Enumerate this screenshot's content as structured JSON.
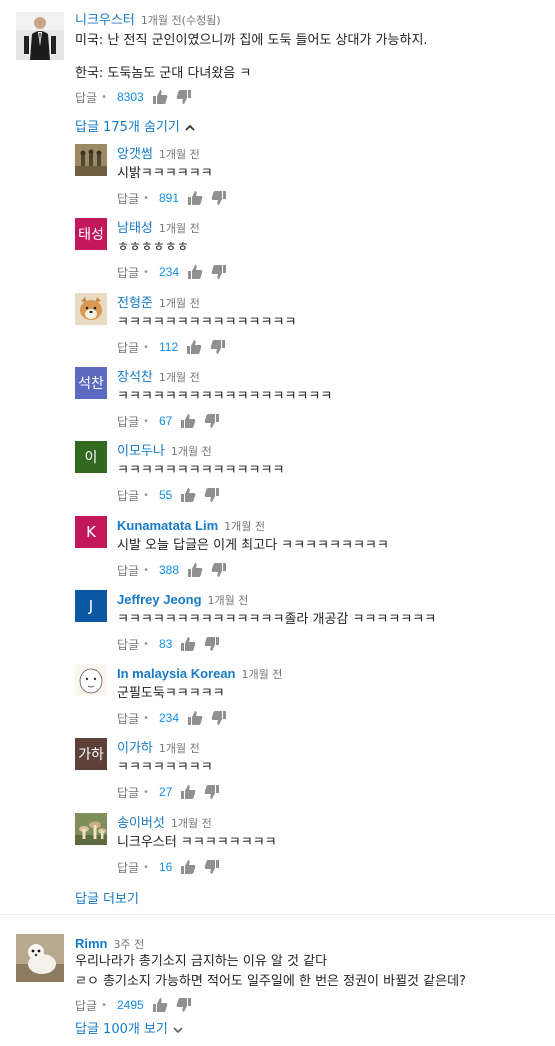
{
  "top_comment": {
    "author": "니크우스터",
    "time": "1개월 전(수정됨)",
    "text_line1": "미국: 난 전직 군인이였으니까 집에 도둑 들어도 상대가 가능하지.",
    "text_line2": "한국: 도둑놈도 군대 다녀왔음 ㅋ",
    "reply_label": "답글",
    "likes": "8303",
    "hide_replies_label": "답글 175개 숨기기"
  },
  "replies": [
    {
      "author": "앙갯썸",
      "time": "1개월 전",
      "text": "시밝ㅋㅋㅋㅋㅋㅋ",
      "reply_label": "답글",
      "likes": "891",
      "avatar_type": "photo",
      "avatar_color": "#7a6a4e"
    },
    {
      "author": "남태성",
      "time": "1개월 전",
      "text": "ㅎㅎㅎㅎㅎㅎ",
      "reply_label": "답글",
      "likes": "234",
      "avatar_type": "letter",
      "avatar_text": "태성",
      "avatar_color": "#c2185b"
    },
    {
      "author": "전형준",
      "time": "1개월 전",
      "text": "ㅋㅋㅋㅋㅋㅋㅋㅋㅋㅋㅋㅋㅋㅋㅋ",
      "reply_label": "답글",
      "likes": "112",
      "avatar_type": "photo",
      "avatar_color": "#c9a46a"
    },
    {
      "author": "장석찬",
      "time": "1개월 전",
      "text": "ㅋㅋㅋㅋㅋㅋㅋㅋㅋㅋㅋㅋㅋㅋㅋㅋㅋㅋ",
      "reply_label": "답글",
      "likes": "67",
      "avatar_type": "letter",
      "avatar_text": "석찬",
      "avatar_color": "#5c6bc0"
    },
    {
      "author": "이모두나",
      "time": "1개월 전",
      "text": "ㅋㅋㅋㅋㅋㅋㅋㅋㅋㅋㅋㅋㅋㅋ",
      "reply_label": "답글",
      "likes": "55",
      "avatar_type": "letter",
      "avatar_text": "이",
      "avatar_color": "#33691e"
    },
    {
      "author": "Kunamatata Lim",
      "time": "1개월 전",
      "text": "시발 오늘 답글은 이게 최고다 ㅋㅋㅋㅋㅋㅋㅋㅋㅋ",
      "reply_label": "답글",
      "likes": "388",
      "avatar_type": "letter",
      "avatar_text": "K",
      "avatar_color": "#c2185b"
    },
    {
      "author": "Jeffrey Jeong",
      "time": "1개월 전",
      "text": "ㅋㅋㅋㅋㅋㅋㅋㅋㅋㅋㅋㅋㅋㅋ졸라 개공감 ㅋㅋㅋㅋㅋㅋㅋ",
      "reply_label": "답글",
      "likes": "83",
      "avatar_type": "letter",
      "avatar_text": "J",
      "avatar_color": "#0b57a4"
    },
    {
      "author": "In malaysia Korean",
      "time": "1개월 전",
      "text": "군필도둑ㅋㅋㅋㅋㅋ",
      "reply_label": "답글",
      "likes": "234",
      "avatar_type": "photo",
      "avatar_color": "#f1e6d4"
    },
    {
      "author": "이가하",
      "time": "1개월 전",
      "text": "ㅋㅋㅋㅋㅋㅋㅋㅋ",
      "reply_label": "답글",
      "likes": "27",
      "avatar_type": "letter",
      "avatar_text": "가하",
      "avatar_color": "#5d4037"
    },
    {
      "author": "송이버섯",
      "time": "1개월 전",
      "text": "니크우스터 ㅋㅋㅋㅋㅋㅋㅋㅋ",
      "reply_label": "답글",
      "likes": "16",
      "avatar_type": "photo",
      "avatar_color": "#9aa37a"
    }
  ],
  "more_replies_label": "답글 더보기",
  "second_comment": {
    "author": "Rimn",
    "time": "3주 전",
    "text_line1": "우리나라가 총기소지 금지하는 이유 알 것 같다",
    "text_line2": "ㄹㅇ 총기소지 가능하면 적어도 일주일에 한 번은 정권이 바뀔것 같은데?",
    "reply_label": "답글",
    "likes": "2495",
    "view_replies_label": "답글 100개 보기"
  },
  "colors": {
    "link": "#167ac6",
    "likes": "#128ee9",
    "muted": "#767676"
  }
}
